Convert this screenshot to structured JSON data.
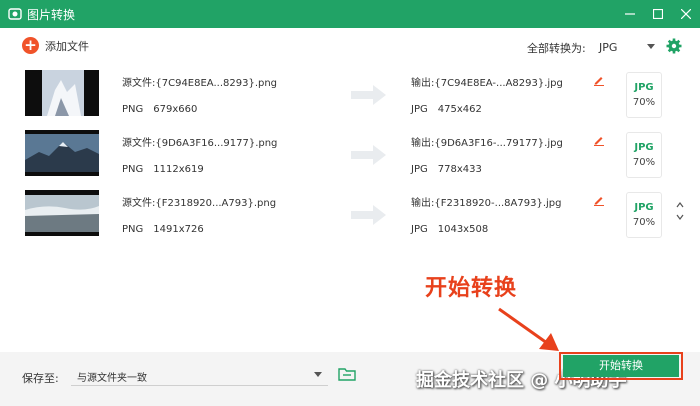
{
  "titlebar": {
    "title": "图片转换"
  },
  "toolbar": {
    "add_label": "添加文件",
    "convert_all_label": "全部转换为:",
    "format_value": "JPG"
  },
  "files": [
    {
      "src_label": "源文件:",
      "src_name": "{7C94E8EA...8293}.png",
      "src_format": "PNG",
      "src_size": "679x660",
      "out_label": "输出:",
      "out_name": "{7C94E8EA-...A8293}.jpg",
      "out_format": "JPG",
      "out_size": "475x462",
      "fmt": "JPG",
      "quality": "70%"
    },
    {
      "src_label": "源文件:",
      "src_name": "{9D6A3F16...9177}.png",
      "src_format": "PNG",
      "src_size": "1112x619",
      "out_label": "输出:",
      "out_name": "{9D6A3F16-...79177}.jpg",
      "out_format": "JPG",
      "out_size": "778x433",
      "fmt": "JPG",
      "quality": "70%"
    },
    {
      "src_label": "源文件:",
      "src_name": "{F2318920...A793}.png",
      "src_format": "PNG",
      "src_size": "1491x726",
      "out_label": "输出:",
      "out_name": "{F2318920-...8A793}.jpg",
      "out_format": "JPG",
      "out_size": "1043x508",
      "fmt": "JPG",
      "quality": "70%"
    }
  ],
  "annotation": {
    "text": "开始转换"
  },
  "bottom": {
    "save_label": "保存至:",
    "save_value": "与源文件夹一致",
    "start_label": "开始转换",
    "watermark": "掘金技术社区 @ 小明助手"
  },
  "colors": {
    "accent": "#21a366",
    "add": "#f0532a",
    "highlight": "#e8411c"
  }
}
